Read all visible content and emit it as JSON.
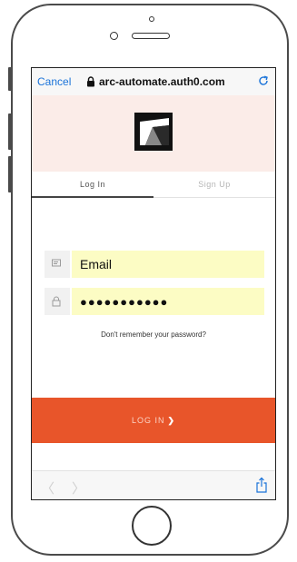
{
  "browser": {
    "cancel_label": "Cancel",
    "host": "arc-automate.auth0.com"
  },
  "tabs": {
    "login_label": "Log In",
    "signup_label": "Sign Up",
    "active": "login"
  },
  "form": {
    "email_value": "Email",
    "password_value": "●●●●●●●●●●●",
    "forgot_label": "Don't remember your password?",
    "submit_label": "LOG IN",
    "submit_chevron": "❯"
  },
  "toolbar": {
    "back_glyph": "〈",
    "forward_glyph": "〉"
  },
  "icons": {
    "lock": "lock-icon",
    "reload": "reload-icon",
    "logo": "brand-logo",
    "email": "envelope-icon",
    "password": "padlock-icon",
    "share": "share-icon"
  },
  "colors": {
    "accent": "#e8552a",
    "header_bg": "#fbece8",
    "input_bg": "#fcfcc4",
    "link_blue": "#1a73d9"
  }
}
